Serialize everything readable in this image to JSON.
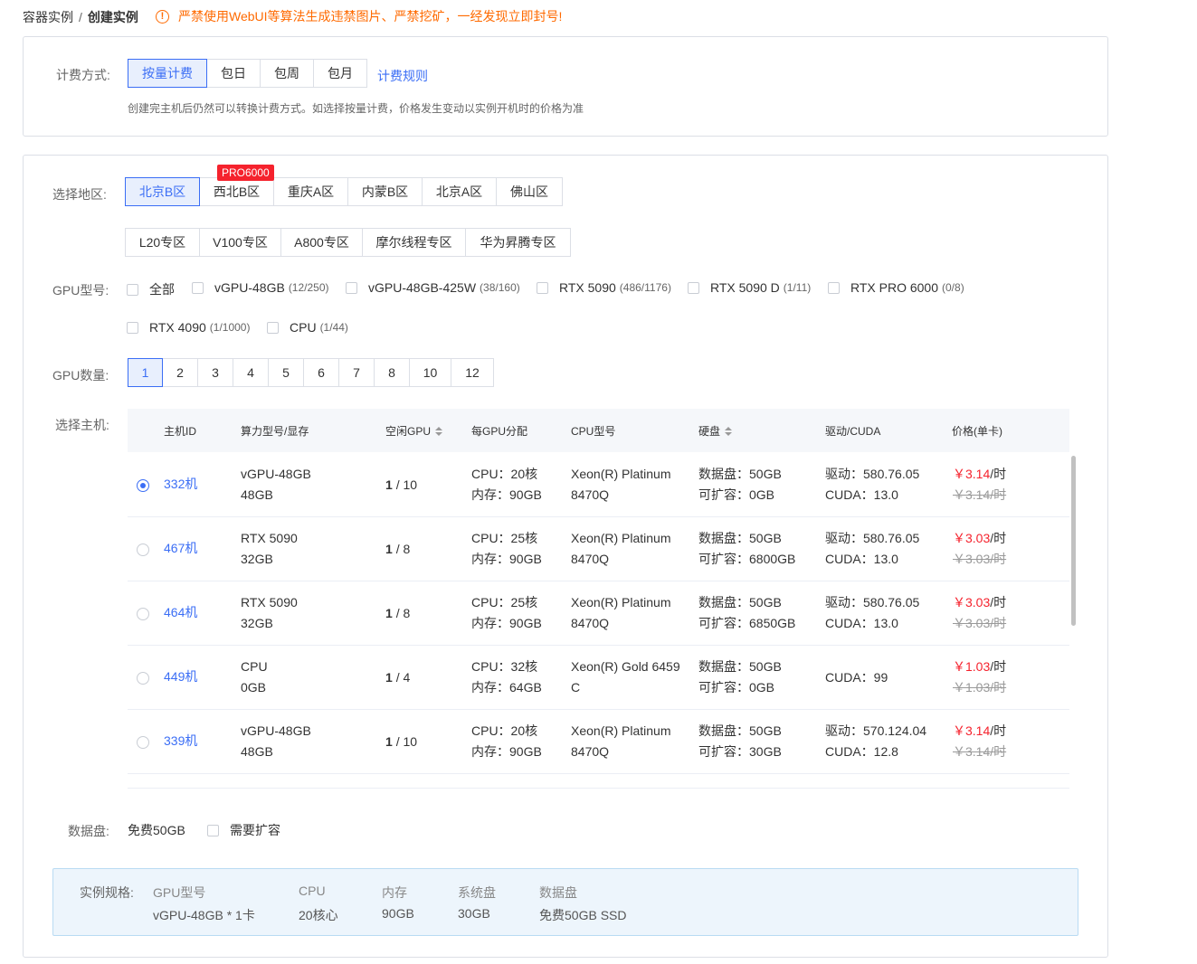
{
  "breadcrumb": {
    "parent": "容器实例",
    "separator": "/",
    "current": "创建实例"
  },
  "warning": {
    "icon": "exclamation-circle-icon",
    "text": "严禁使用WebUI等算法生成违禁图片、严禁挖矿，一经发现立即封号!"
  },
  "billing": {
    "label": "计费方式:",
    "options": [
      "按量计费",
      "包日",
      "包周",
      "包月"
    ],
    "selected": "按量计费",
    "rules_link": "计费规则",
    "hint": "创建完主机后仍然可以转换计费方式。如选择按量计费，价格发生变动以实例开机时的价格为准"
  },
  "region": {
    "label": "选择地区:",
    "row1": [
      "北京B区",
      "西北B区",
      "重庆A区",
      "内蒙B区",
      "北京A区",
      "佛山区"
    ],
    "row2": [
      "L20专区",
      "V100专区",
      "A800专区",
      "摩尔线程专区",
      "华为昇腾专区"
    ],
    "selected": "北京B区",
    "badge": "PRO6000"
  },
  "gpu_model": {
    "label": "GPU型号:",
    "options": [
      {
        "name": "全部",
        "count": ""
      },
      {
        "name": "vGPU-48GB",
        "count": "(12/250)"
      },
      {
        "name": "vGPU-48GB-425W",
        "count": "(38/160)"
      },
      {
        "name": "RTX 5090",
        "count": "(486/1176)"
      },
      {
        "name": "RTX 5090 D",
        "count": "(1/11)"
      },
      {
        "name": "RTX PRO 6000",
        "count": "(0/8)"
      },
      {
        "name": "RTX 4090",
        "count": "(1/1000)"
      },
      {
        "name": "CPU",
        "count": "(1/44)"
      }
    ]
  },
  "gpu_count": {
    "label": "GPU数量:",
    "options": [
      "1",
      "2",
      "3",
      "4",
      "5",
      "6",
      "7",
      "8",
      "10",
      "12"
    ],
    "selected": "1"
  },
  "host": {
    "label": "选择主机:",
    "columns": [
      "主机ID",
      "算力型号/显存",
      "空闲GPU",
      "每GPU分配",
      "CPU型号",
      "硬盘",
      "驱动/CUDA",
      "价格(单卡)"
    ],
    "rows": [
      {
        "id": "332机",
        "model": "vGPU-48GB",
        "vram": "48GB",
        "free": "1",
        "total": "/ 10",
        "cpu": "CPU：20核",
        "mem": "内存：90GB",
        "cpu_model1": "Xeon(R) Platinum",
        "cpu_model2": "8470Q",
        "disk": "数据盘：50GB",
        "expand": "可扩容：0GB",
        "driver": "驱动：580.76.05",
        "cuda": "CUDA：13.0",
        "price": "￥3.14",
        "unit": "/时",
        "orig": "￥3.14/时",
        "selected": true
      },
      {
        "id": "467机",
        "model": "RTX 5090",
        "vram": "32GB",
        "free": "1",
        "total": "/ 8",
        "cpu": "CPU：25核",
        "mem": "内存：90GB",
        "cpu_model1": "Xeon(R) Platinum",
        "cpu_model2": "8470Q",
        "disk": "数据盘：50GB",
        "expand": "可扩容：6800GB",
        "driver": "驱动：580.76.05",
        "cuda": "CUDA：13.0",
        "price": "￥3.03",
        "unit": "/时",
        "orig": "￥3.03/时",
        "selected": false
      },
      {
        "id": "464机",
        "model": "RTX 5090",
        "vram": "32GB",
        "free": "1",
        "total": "/ 8",
        "cpu": "CPU：25核",
        "mem": "内存：90GB",
        "cpu_model1": "Xeon(R) Platinum",
        "cpu_model2": "8470Q",
        "disk": "数据盘：50GB",
        "expand": "可扩容：6850GB",
        "driver": "驱动：580.76.05",
        "cuda": "CUDA：13.0",
        "price": "￥3.03",
        "unit": "/时",
        "orig": "￥3.03/时",
        "selected": false
      },
      {
        "id": "449机",
        "model": "CPU",
        "vram": "0GB",
        "free": "1",
        "total": "/ 4",
        "cpu": "CPU：32核",
        "mem": "内存：64GB",
        "cpu_model1": "Xeon(R) Gold 6459",
        "cpu_model2": "C",
        "disk": "数据盘：50GB",
        "expand": "可扩容：0GB",
        "driver": "",
        "cuda": "CUDA：99",
        "price": "￥1.03",
        "unit": "/时",
        "orig": "￥1.03/时",
        "selected": false
      },
      {
        "id": "339机",
        "model": "vGPU-48GB",
        "vram": "48GB",
        "free": "1",
        "total": "/ 10",
        "cpu": "CPU：20核",
        "mem": "内存：90GB",
        "cpu_model1": "Xeon(R) Platinum",
        "cpu_model2": "8470Q",
        "disk": "数据盘：50GB",
        "expand": "可扩容：30GB",
        "driver": "驱动：570.124.04",
        "cuda": "CUDA：12.8",
        "price": "￥3.14",
        "unit": "/时",
        "orig": "￥3.14/时",
        "selected": false
      }
    ]
  },
  "data_disk": {
    "label": "数据盘:",
    "value": "免费50GB",
    "expand_label": "需要扩容"
  },
  "spec": {
    "label": "实例规格:",
    "headers": [
      "GPU型号",
      "CPU",
      "内存",
      "系统盘",
      "数据盘"
    ],
    "values": [
      "vGPU-48GB * 1卡",
      "20核心",
      "90GB",
      "30GB",
      "免费50GB SSD"
    ]
  },
  "colors": {
    "primary": "#3b6ef5",
    "warning": "#ff6a00",
    "price": "#f5222d"
  }
}
